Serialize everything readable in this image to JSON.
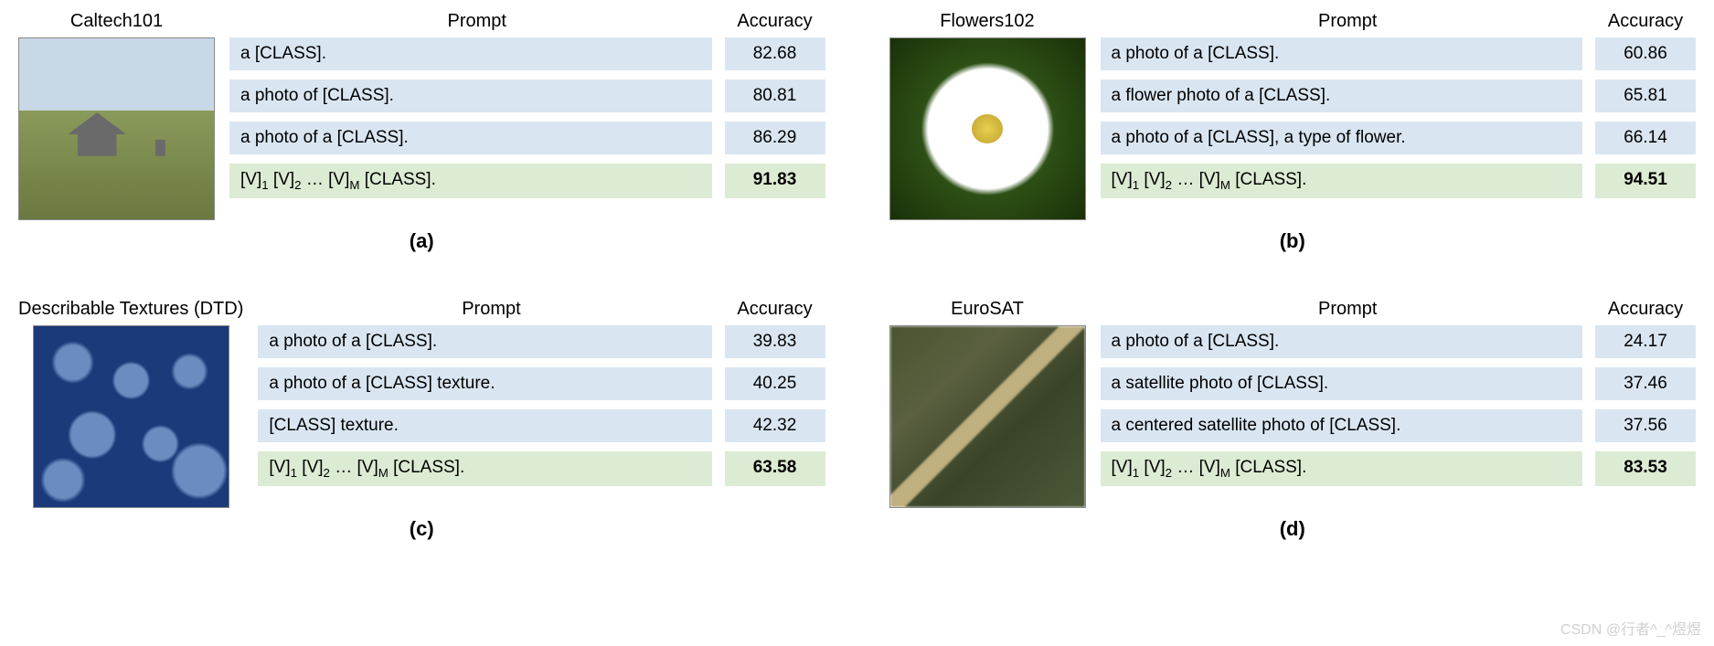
{
  "headers": {
    "prompt": "Prompt",
    "accuracy": "Accuracy"
  },
  "learned_prompt": "[V]₁ [V]₂ … [V]ₘ [CLASS].",
  "panels": [
    {
      "label": "(a)",
      "dataset": "Caltech101",
      "rows": [
        {
          "prompt": "a [CLASS].",
          "acc": "82.68"
        },
        {
          "prompt": "a photo of [CLASS].",
          "acc": "80.81"
        },
        {
          "prompt": "a photo of a [CLASS].",
          "acc": "86.29"
        }
      ],
      "learned_acc": "91.83"
    },
    {
      "label": "(b)",
      "dataset": "Flowers102",
      "rows": [
        {
          "prompt": "a photo of a [CLASS].",
          "acc": "60.86"
        },
        {
          "prompt": "a flower photo of a [CLASS].",
          "acc": "65.81"
        },
        {
          "prompt": "a photo of a [CLASS], a type of flower.",
          "acc": "66.14"
        }
      ],
      "learned_acc": "94.51"
    },
    {
      "label": "(c)",
      "dataset": "Describable Textures (DTD)",
      "rows": [
        {
          "prompt": "a photo of a [CLASS].",
          "acc": "39.83"
        },
        {
          "prompt": "a photo of a [CLASS] texture.",
          "acc": "40.25"
        },
        {
          "prompt": "[CLASS] texture.",
          "acc": "42.32"
        }
      ],
      "learned_acc": "63.58"
    },
    {
      "label": "(d)",
      "dataset": "EuroSAT",
      "rows": [
        {
          "prompt": "a photo of a [CLASS].",
          "acc": "24.17"
        },
        {
          "prompt": "a satellite photo of [CLASS].",
          "acc": "37.46"
        },
        {
          "prompt": "a centered satellite photo of [CLASS].",
          "acc": "37.56"
        }
      ],
      "learned_acc": "83.53"
    }
  ],
  "watermark": "CSDN @行者^_^煜煜",
  "chart_data": {
    "type": "table",
    "title": "Prompt engineering vs learned prompts — classification accuracy across datasets",
    "datasets": [
      {
        "name": "Caltech101",
        "hand_crafted": [
          {
            "prompt": "a [CLASS].",
            "accuracy": 82.68
          },
          {
            "prompt": "a photo of [CLASS].",
            "accuracy": 80.81
          },
          {
            "prompt": "a photo of a [CLASS].",
            "accuracy": 86.29
          }
        ],
        "learned": {
          "prompt": "[V]1 [V]2 … [V]M [CLASS].",
          "accuracy": 91.83
        }
      },
      {
        "name": "Flowers102",
        "hand_crafted": [
          {
            "prompt": "a photo of a [CLASS].",
            "accuracy": 60.86
          },
          {
            "prompt": "a flower photo of a [CLASS].",
            "accuracy": 65.81
          },
          {
            "prompt": "a photo of a [CLASS], a type of flower.",
            "accuracy": 66.14
          }
        ],
        "learned": {
          "prompt": "[V]1 [V]2 … [V]M [CLASS].",
          "accuracy": 94.51
        }
      },
      {
        "name": "Describable Textures (DTD)",
        "hand_crafted": [
          {
            "prompt": "a photo of a [CLASS].",
            "accuracy": 39.83
          },
          {
            "prompt": "a photo of a [CLASS] texture.",
            "accuracy": 40.25
          },
          {
            "prompt": "[CLASS] texture.",
            "accuracy": 42.32
          }
        ],
        "learned": {
          "prompt": "[V]1 [V]2 … [V]M [CLASS].",
          "accuracy": 63.58
        }
      },
      {
        "name": "EuroSAT",
        "hand_crafted": [
          {
            "prompt": "a photo of a [CLASS].",
            "accuracy": 24.17
          },
          {
            "prompt": "a satellite photo of [CLASS].",
            "accuracy": 37.46
          },
          {
            "prompt": "a centered satellite photo of [CLASS].",
            "accuracy": 37.56
          }
        ],
        "learned": {
          "prompt": "[V]1 [V]2 … [V]M [CLASS].",
          "accuracy": 83.53
        }
      }
    ]
  }
}
